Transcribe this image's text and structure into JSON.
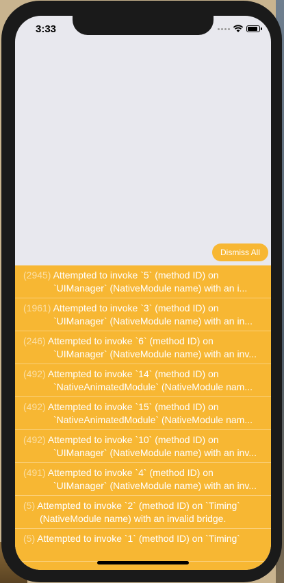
{
  "status_bar": {
    "time": "3:33"
  },
  "dismiss_all_label": "Dismiss All",
  "log_items": [
    {
      "count": "(2945)",
      "line1": "Attempted to invoke `5` (method ID) on",
      "line2": "`UIManager` (NativeModule name) with an i..."
    },
    {
      "count": "(1961)",
      "line1": "Attempted to invoke `3` (method ID) on",
      "line2": "`UIManager` (NativeModule name) with an in..."
    },
    {
      "count": "(246)",
      "line1": "Attempted to invoke `6` (method ID) on",
      "line2": "`UIManager` (NativeModule name) with an inv..."
    },
    {
      "count": "(492)",
      "line1": "Attempted to invoke `14` (method ID) on",
      "line2": "`NativeAnimatedModule` (NativeModule nam..."
    },
    {
      "count": "(492)",
      "line1": "Attempted to invoke `15` (method ID) on",
      "line2": "`NativeAnimatedModule` (NativeModule nam..."
    },
    {
      "count": "(492)",
      "line1": "Attempted to invoke `10` (method ID) on",
      "line2": "`UIManager` (NativeModule name) with an inv..."
    },
    {
      "count": "(491)",
      "line1": "Attempted to invoke `4` (method ID) on",
      "line2": "`UIManager` (NativeModule name) with an inv..."
    },
    {
      "count": "(5)",
      "line1": "Attempted to invoke `2` (method ID) on `Timing`",
      "line2": "(NativeModule name) with an invalid bridge."
    },
    {
      "count": "(5)",
      "line1": "Attempted to invoke `1` (method ID) on `Timing`",
      "line2": ""
    }
  ],
  "colors": {
    "warning_yellow": "#f7b733",
    "screen_background": "#e8e8ee"
  }
}
